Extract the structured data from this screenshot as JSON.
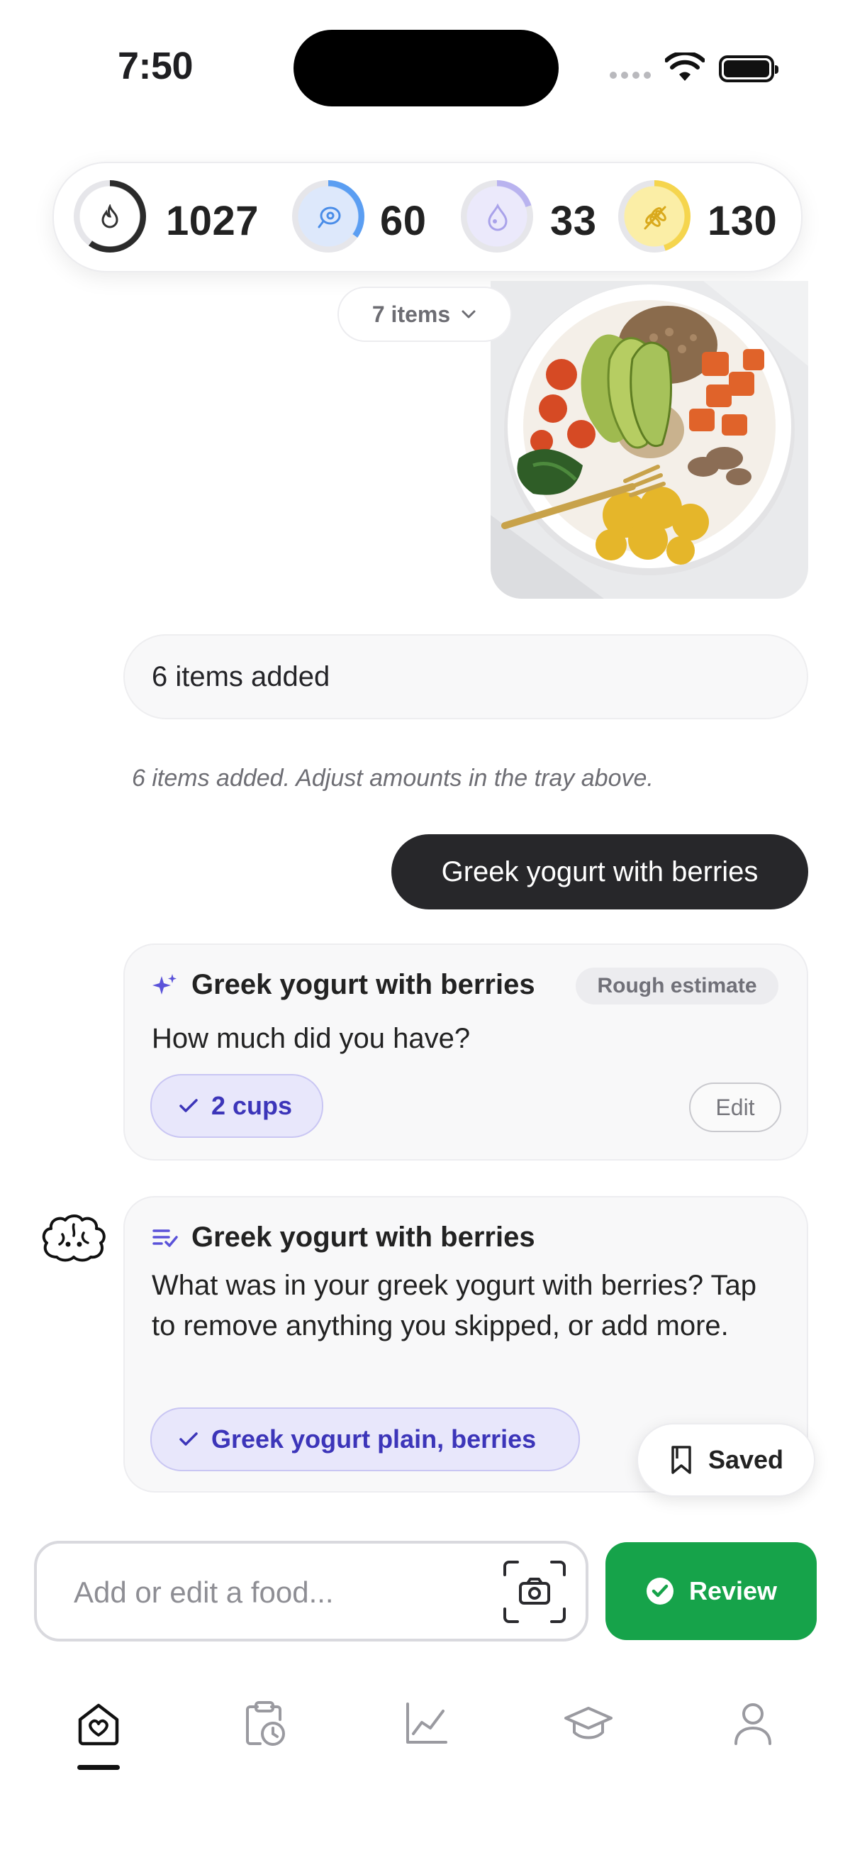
{
  "status_bar": {
    "time": "7:50"
  },
  "macros": {
    "calories": {
      "value": "1027",
      "icon": "flame-icon",
      "progress": 0.6,
      "color": "#2b2b2b"
    },
    "protein": {
      "value": "60",
      "icon": "meat-icon",
      "progress": 0.35,
      "color": "#5b9ef2"
    },
    "fat": {
      "value": "33",
      "icon": "drop-icon",
      "progress": 0.2,
      "color": "#b9b3ef"
    },
    "carbs": {
      "value": "130",
      "icon": "wheat-icon",
      "progress": 0.45,
      "color": "#f5d54e"
    }
  },
  "items_dropdown": {
    "label": "7 items"
  },
  "chat": {
    "added_card": {
      "text": "6 items added"
    },
    "added_note": "6 items added. Adjust amounts in the tray above.",
    "user_message": "Greek yogurt with berries",
    "amount_card": {
      "title": "Greek yogurt with berries",
      "badge": "Rough estimate",
      "question": "How much did you have?",
      "chip": "2 cups",
      "edit_label": "Edit"
    },
    "ingredients_card": {
      "title": "Greek yogurt with berries",
      "question": "What was in your greek yogurt with berries? Tap to remove anything you skipped, or add more.",
      "chip": "Greek yogurt plain, berries"
    }
  },
  "saved_button": {
    "label": "Saved"
  },
  "composer": {
    "placeholder": "Add or edit a food..."
  },
  "review_button": {
    "label": "Review"
  },
  "tabbar": {
    "tabs": [
      {
        "icon": "home-heart-icon",
        "active": true
      },
      {
        "icon": "clipboard-clock-icon",
        "active": false
      },
      {
        "icon": "chart-line-icon",
        "active": false
      },
      {
        "icon": "graduation-cap-icon",
        "active": false
      },
      {
        "icon": "person-icon",
        "active": false
      }
    ]
  },
  "colors": {
    "accent": "#3c35b9",
    "review_green": "#16a34a",
    "user_bubble": "#27272a"
  }
}
